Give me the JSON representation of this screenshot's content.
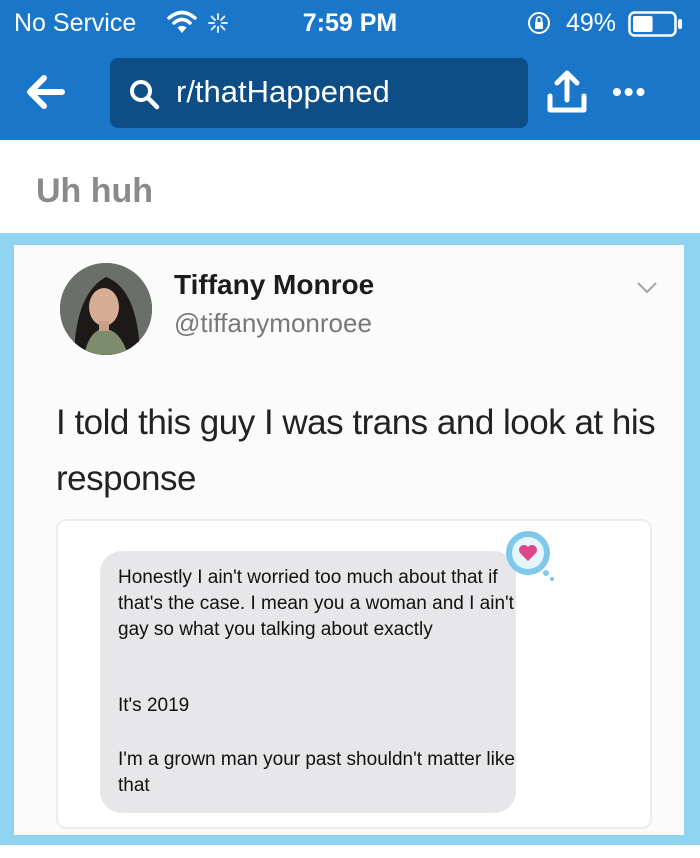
{
  "status_bar": {
    "carrier": "No Service",
    "time": "7:59 PM",
    "battery_percent": "49%",
    "battery_level": 0.49,
    "icons": [
      "wifi-icon",
      "loading-spinner-icon",
      "orientation-lock-icon",
      "battery-icon"
    ]
  },
  "header": {
    "search_query": "r/thatHappened",
    "icons": [
      "back-arrow-icon",
      "search-icon",
      "share-icon",
      "more-icon"
    ],
    "more_glyph": "•••"
  },
  "post": {
    "title": "Uh huh"
  },
  "tweet": {
    "display_name": "Tiffany Monroe",
    "handle": "@tiffanymonroee",
    "text": "I told this guy I was trans and look at his response",
    "message_lines": [
      "Honestly I ain't worried too much about that if that's the case. I mean you a woman and I ain't gay so what you talking about exactly",
      "It's 2019",
      "I'm a grown man your past shouldn't matter like that"
    ]
  },
  "colors": {
    "header_blue": "#1a76c9",
    "search_box": "#0e4e86",
    "frame_blue": "#8fd4f0",
    "bubble_gray": "#e7e7ea",
    "heart_pink": "#e0468a"
  }
}
